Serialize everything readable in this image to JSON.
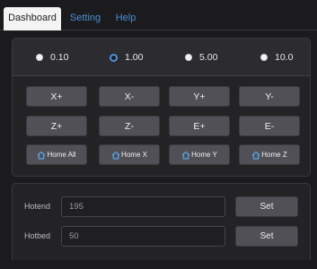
{
  "tabs": [
    {
      "label": "Dashboard",
      "active": true
    },
    {
      "label": "Setting",
      "active": false
    },
    {
      "label": "Help",
      "active": false
    }
  ],
  "step_options": [
    {
      "label": "0.10",
      "checked": false
    },
    {
      "label": "1.00",
      "checked": true
    },
    {
      "label": "5.00",
      "checked": false
    },
    {
      "label": "10.0",
      "checked": false
    }
  ],
  "jog_buttons": {
    "x_plus": "X+",
    "x_minus": "X-",
    "y_plus": "Y+",
    "y_minus": "Y-",
    "z_plus": "Z+",
    "z_minus": "Z-",
    "e_plus": "E+",
    "e_minus": "E-"
  },
  "home_buttons": {
    "all": "Home All",
    "x": "Home X",
    "y": "Home Y",
    "z": "Home Z",
    "icon": "home-icon"
  },
  "temperature": {
    "hotend": {
      "label": "Hotend",
      "value": "195",
      "set_label": "Set"
    },
    "hotbed": {
      "label": "Hotbed",
      "value": "50",
      "set_label": "Set"
    }
  },
  "colors": {
    "accent": "#4a8fd4",
    "background": "#1b1b1d",
    "button": "#505056",
    "active_tab": "#f4f4f4"
  }
}
